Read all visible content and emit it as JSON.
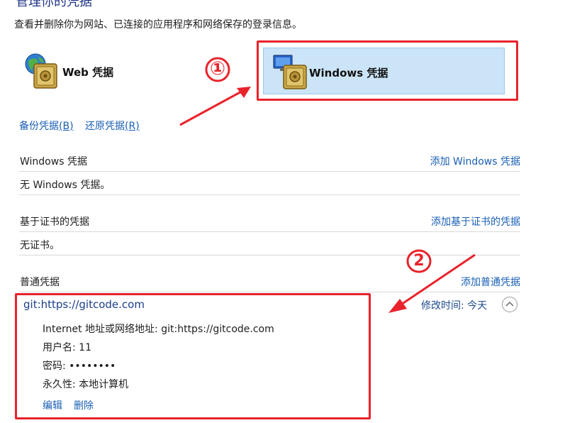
{
  "header": {
    "title": "管理你的凭据",
    "subtitle": "查看并删除你为网站、已连接的应用程序和网络保存的登录信息。"
  },
  "tiles": {
    "web": {
      "label": "Web 凭据"
    },
    "windows": {
      "label": "Windows 凭据"
    }
  },
  "actions": {
    "backup": "备份凭据",
    "backup_key": "(B)",
    "restore": "还原凭据",
    "restore_key": "(R)"
  },
  "sections": {
    "windows": {
      "heading": "Windows 凭据",
      "add": "添加 Windows 凭据",
      "empty": "无 Windows 凭据。"
    },
    "certificate": {
      "heading": "基于证书的凭据",
      "add": "添加基于证书的凭据",
      "empty": "无证书。"
    },
    "generic": {
      "heading": "普通凭据",
      "add": "添加普通凭据"
    }
  },
  "credential": {
    "name": "git:https://gitcode.com",
    "modified": "修改时间: 今天",
    "address_label": "Internet 地址或网络地址:",
    "address_value": "git:https://gitcode.com",
    "username_label": "用户名:",
    "username_value": "11",
    "password_label": "密码:",
    "password_value": "••••••••",
    "persistence_label": "永久性:",
    "persistence_value": "本地计算机",
    "edit": "编辑",
    "delete": "删除"
  },
  "annotations": {
    "one": "①",
    "two": "2",
    "color": "#e8232b"
  }
}
